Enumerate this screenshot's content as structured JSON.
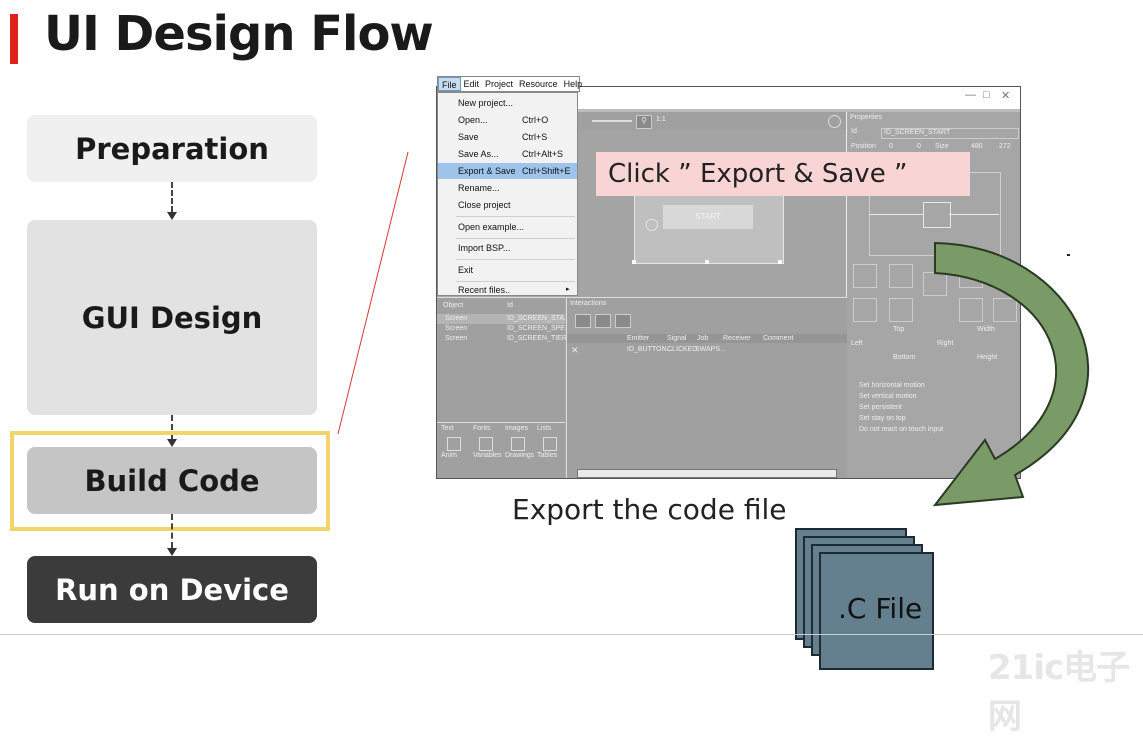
{
  "slide": {
    "title": "UI Design Flow",
    "accent_color": "#e0201c"
  },
  "flow": {
    "steps": [
      {
        "label": "Preparation"
      },
      {
        "label": "GUI Design"
      },
      {
        "label": "Build Code"
      },
      {
        "label": "Run on Device"
      }
    ],
    "highlight_color": "#f2d46a"
  },
  "app": {
    "menubar": [
      "File",
      "Edit",
      "Project",
      "Resource",
      "Help"
    ],
    "file_menu": [
      {
        "label": "New project...",
        "shortcut": ""
      },
      {
        "label": "Open...",
        "shortcut": "Ctrl+O"
      },
      {
        "label": "Save",
        "shortcut": "Ctrl+S"
      },
      {
        "label": "Save As...",
        "shortcut": "Ctrl+Alt+S"
      },
      {
        "label": "Export & Save",
        "shortcut": "Ctrl+Shift+E"
      },
      {
        "label": "Rename...",
        "shortcut": ""
      },
      {
        "label": "Close project",
        "shortcut": ""
      },
      {
        "label": "Open example...",
        "shortcut": ""
      },
      {
        "label": "Import BSP...",
        "shortcut": ""
      },
      {
        "label": "Exit",
        "shortcut": ""
      },
      {
        "label": "Recent files..",
        "shortcut": ""
      }
    ],
    "properties": {
      "header": "Properties",
      "id_label": "Id",
      "id_value": "ID_SCREEN_START",
      "position_label": "Position",
      "pos_x": "0",
      "pos_y": "0",
      "size_label": "Size",
      "width": "480",
      "height": "272",
      "top_label": "Top",
      "width_label": "Width",
      "left_label": "Left",
      "right_label": "Right",
      "bottom_label": "Bottom",
      "height_label": "Height",
      "options": [
        "Set horizontal motion",
        "Set vertical motion",
        "Set persistent",
        "Set stay on top",
        "Do not react on touch input"
      ]
    },
    "objects": {
      "col_object": "Object",
      "col_id": "Id",
      "rows": [
        {
          "type": "Screen",
          "id": "ID_SCREEN_STA..."
        },
        {
          "type": "Screen",
          "id": "ID_SCREEN_SPE..."
        },
        {
          "type": "Screen",
          "id": "ID_SCREEN_TIER..."
        }
      ]
    },
    "interactions": {
      "header": "Interactions",
      "columns": [
        "Emitter",
        "Signal",
        "Job",
        "Receiver",
        "Comment"
      ],
      "row": {
        "emitter": "ID_BUTTON...",
        "signal": "CLICKED",
        "job": "SWAPS..."
      }
    },
    "toolbox": {
      "tabs": [
        "Text",
        "Fonts",
        "Images",
        "Lists"
      ],
      "items": [
        "Anim",
        "Variables",
        "Drawings",
        "Tables"
      ]
    },
    "canvas": {
      "button_text": "START",
      "zoom": "1:1"
    }
  },
  "callout": {
    "text": "Click ” Export & Save ”"
  },
  "caption": "Export the code file",
  "file_stack": {
    "label": ".C File",
    "card_color": "#64808e"
  },
  "arrow_color": "#7a9a68",
  "watermark": "21ic电子网"
}
